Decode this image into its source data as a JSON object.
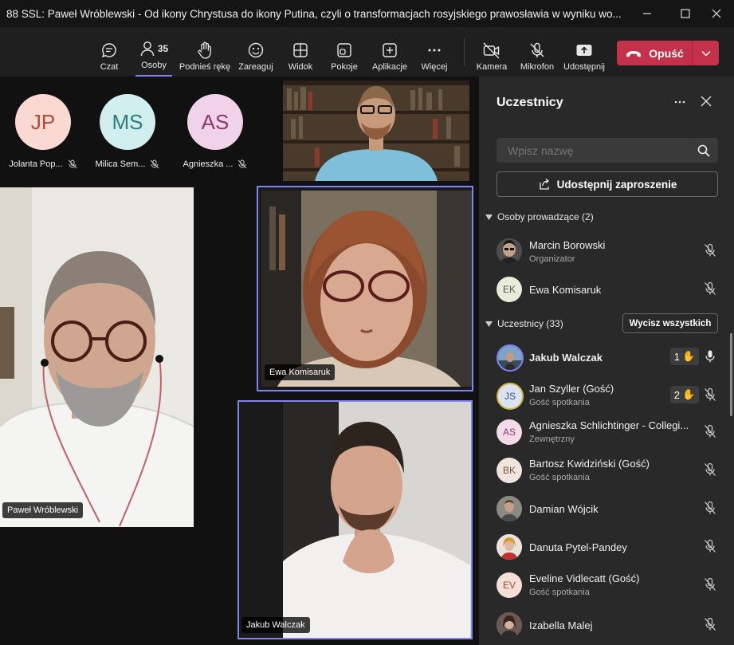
{
  "window": {
    "title": "88 SSL: Paweł Wróblewski - Od ikony Chrystusa do ikony Putina, czyli o transformacjach rosyjskiego prawosławia w wyniku wo..."
  },
  "toolbar": {
    "chat": "Czat",
    "people": "Osoby",
    "people_count": "35",
    "raise_hand": "Podnieś rękę",
    "react": "Zareaguj",
    "view": "Widok",
    "rooms": "Pokoje",
    "apps": "Aplikacje",
    "more": "Więcej",
    "camera": "Kamera",
    "mic": "Mikrofon",
    "share": "Udostępnij",
    "leave": "Opuść",
    "leave_color": "#c4314b",
    "active_color": "#7f85f5"
  },
  "stage": {
    "avatars": [
      {
        "initials": "JP",
        "name": "Jolanta Pop...",
        "bg": "#fbd9d3",
        "fg": "#b44a3b"
      },
      {
        "initials": "MS",
        "name": "Milica Sem...",
        "bg": "#d1efef",
        "fg": "#2e7b7b"
      },
      {
        "initials": "AS",
        "name": "Agnieszka ...",
        "bg": "#f0d3e8",
        "fg": "#8a3b6e"
      }
    ],
    "videos": {
      "ewa": "Ewa Komisaruk",
      "pawel": "Paweł Wróblewski",
      "jakub": "Jakub Walczak"
    }
  },
  "panel": {
    "title": "Uczestnicy",
    "search_placeholder": "Wpisz nazwę",
    "share_invite": "Udostępnij zaproszenie",
    "organizers_header": "Osoby prowadzące (2)",
    "participants_header": "Uczestnicy (33)",
    "mute_all": "Wycisz wszystkich",
    "organizers": [
      {
        "name": "Marcin Borowski",
        "sub": "Organizator"
      },
      {
        "initials": "EK",
        "name": "Ewa Komisaruk"
      }
    ],
    "participants": [
      {
        "name": "Jakub Walczak",
        "hand": "1"
      },
      {
        "initials": "JS",
        "name": "Jan Szyller (Gość)",
        "sub": "Gość spotkania",
        "hand": "2"
      },
      {
        "initials": "AS",
        "name": "Agnieszka Schlichtinger - Collegi...",
        "sub": "Zewnętrzny"
      },
      {
        "initials": "BK",
        "name": "Bartosz Kwidziński (Gość)",
        "sub": "Gość spotkania"
      },
      {
        "name": "Damian Wójcik"
      },
      {
        "name": "Danuta Pytel-Pandey"
      },
      {
        "initials": "EV",
        "name": "Eveline Vidlecatt (Gość)",
        "sub": "Gość spotkania"
      },
      {
        "name": "Izabella Malej"
      }
    ]
  }
}
